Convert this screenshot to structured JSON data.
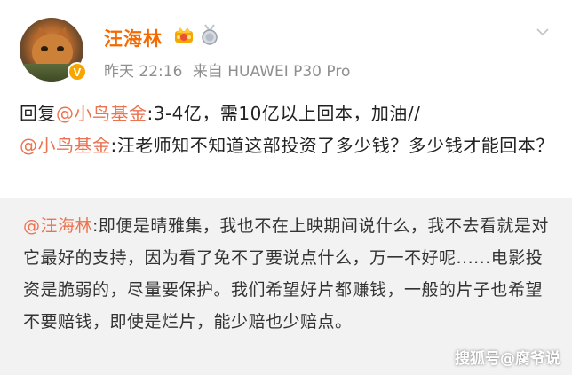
{
  "post": {
    "user": {
      "name": "汪海林",
      "verified_badge": "V"
    },
    "meta": {
      "time": "昨天 22:16",
      "source": "来自 HUAWEI P30 Pro"
    },
    "reply": {
      "prefix": "回复",
      "mention1": "@小鸟基金",
      "text1": ":3-4亿，需10亿以上回本，加油//",
      "mention2": "@小鸟基金",
      "text2": ":汪老师知不知道这部投资了多少钱？多少钱才能回本？"
    }
  },
  "quote": {
    "mention": "@汪海林",
    "text": ":即便是晴雅集，我也不在上映期间说什么，我不去看就是对它最好的支持，因为看了免不了要说点什么，万一不好呢......电影投资是脆弱的，尽量要保护。我们希望好片都赚钱，一般的片子也希望不要赔钱，即使是烂片，能少赔也少赔点。"
  },
  "watermark": "搜狐号@腐爷说",
  "colors": {
    "username": "#f56a00",
    "mention": "#eb7350",
    "meta": "#8f8f8f",
    "quote_bg": "#f2f2f2",
    "badge": "#f7a600"
  },
  "icons": [
    "crown-icon",
    "medal-icon",
    "chevron-down-icon",
    "verified-badge-icon"
  ]
}
